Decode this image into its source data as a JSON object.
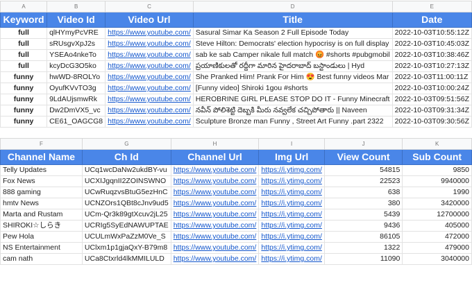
{
  "videos": {
    "columns": [
      "A",
      "B",
      "C",
      "D",
      "E"
    ],
    "headers": [
      "Keyword",
      "Video Id",
      "Video Url",
      "Title",
      "Date"
    ],
    "rows": [
      [
        "full",
        "qlHYmyPcVRE",
        "https://www.youtube.com/",
        "Sasural Simar Ka Season 2 Full Episode Today",
        "2022-10-03T10:55:12Z"
      ],
      [
        "full",
        "sRUsgvXpJ2s",
        "https://www.youtube.com/",
        "Steve Hilton: Democrats' election hypocrisy is on full display",
        "2022-10-03T10:45:03Z"
      ],
      [
        "full",
        "YSEAo4nkeTo",
        "https://www.youtube.com/",
        "sab ke sab Camper nikale full match 😡 #shorts #pubgmobil",
        "2022-10-03T10:38:46Z"
      ],
      [
        "full",
        "kcyDcG3O5ko",
        "https://www.youtube.com/",
        "ప్రయాణికులతో రద్దీగా మారిన హైదరాబాద్ బస్టాండులు | Hyd",
        "2022-10-03T10:27:13Z"
      ],
      [
        "funny",
        "hwWD-8ROLYo",
        "https://www.youtube.com/",
        "She Pranked Him! Prank For Him 😍 Best funny videos Mar",
        "2022-10-03T11:00:11Z"
      ],
      [
        "funny",
        "OyufKVvTO3g",
        "https://www.youtube.com/",
        "[Funny video] Shiroki 1gou #shorts",
        "2022-10-03T10:00:24Z"
      ],
      [
        "funny",
        "9LdAUjsmwRk",
        "https://www.youtube.com/",
        "HEROBRINE GIRL PLEASE STOP DO IT - Funny Minecraft",
        "2022-10-03T09:51:56Z"
      ],
      [
        "funny",
        "Dw2DmVX5_vc",
        "https://www.youtube.com/",
        "నవీన్ పోలిశెట్టి దెబ్బకి మీరు నవ్వలేక చచ్చిపోతారు || Naveen",
        "2022-10-03T09:31:34Z"
      ],
      [
        "funny",
        "CE61_OAGCG8",
        "https://www.youtube.com/",
        "Sculpture Bronze man Funny  , Street Art Funny .part 2322",
        "2022-10-03T09:30:56Z"
      ]
    ]
  },
  "channels": {
    "columns": [
      "F",
      "G",
      "H",
      "I",
      "J",
      "K"
    ],
    "headers": [
      "Channel Name",
      "Ch Id",
      "Channel Url",
      "Img Url",
      "View Count",
      "Sub Count"
    ],
    "rows": [
      [
        "Telly Updates",
        "UCq1wcDaNw2ukdBY-vu",
        "https://www.youtube.com/",
        "https://i.ytimg.com/",
        "54815",
        "9850"
      ],
      [
        "Fox News",
        "UCXIJgqnII2ZOINSWNO",
        "https://www.youtube.com/",
        "https://i.ytimg.com/",
        "22523",
        "9940000"
      ],
      [
        "888 gaming",
        "UCwRuqzvsBtuG5ezHnC",
        "https://www.youtube.com/",
        "https://i.ytimg.com/",
        "638",
        "1990"
      ],
      [
        "hmtv News",
        "UCNZOrs1QBt8cJnv9ud5",
        "https://www.youtube.com/",
        "https://i.ytimg.com/",
        "380",
        "3420000"
      ],
      [
        "Marta and Rustam",
        "UCm-Qr3k89gtXcuv2jL25",
        "https://www.youtube.com/",
        "https://i.ytimg.com/",
        "5439",
        "12700000"
      ],
      [
        "SHIROKI☆しらき",
        "UCRIg5SyEdNAWUPTAE",
        "https://www.youtube.com/",
        "https://i.ytimg.com/",
        "9436",
        "405000"
      ],
      [
        "Pew Hola",
        "UCULmWxPaZzM0Ve_S",
        "https://www.youtube.com/",
        "https://i.ytimg.com/",
        "86105",
        "472000"
      ],
      [
        "NS Entertainment",
        "UClxm1p1gjaQxY-B79m8",
        "https://www.youtube.com/",
        "https://i.ytimg.com/",
        "1322",
        "479000"
      ],
      [
        "cam nath",
        "UCa8Ctxrld4lkMMILULD",
        "https://www.youtube.com/",
        "https://i.ytimg.com/",
        "11090",
        "3040000"
      ]
    ]
  }
}
